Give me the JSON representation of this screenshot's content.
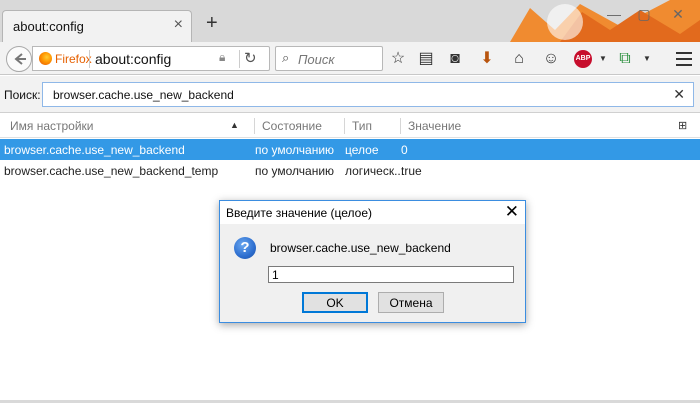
{
  "browser": {
    "tab_title": "about:config",
    "identity_label": "Firefox",
    "url": "about:config",
    "search_placeholder": "Поиск"
  },
  "config": {
    "search_label": "Поиск:",
    "search_value": "browser.cache.use_new_backend",
    "columns": {
      "name": "Имя настройки",
      "status": "Состояние",
      "type": "Тип",
      "value": "Значение"
    },
    "rows": [
      {
        "name": "browser.cache.use_new_backend",
        "status": "по умолчанию",
        "type": "целое",
        "value": "0",
        "selected": true
      },
      {
        "name": "browser.cache.use_new_backend_temp",
        "status": "по умолчанию",
        "type": "логическ...",
        "value": "true",
        "selected": false
      }
    ]
  },
  "dialog": {
    "title": "Введите значение (целое)",
    "message": "browser.cache.use_new_backend",
    "input_value": "1",
    "ok_label": "OK",
    "cancel_label": "Отмена"
  },
  "colors": {
    "selection": "#3399e6",
    "firefox_orange": "#e66000",
    "dialog_border": "#3b8de0"
  }
}
